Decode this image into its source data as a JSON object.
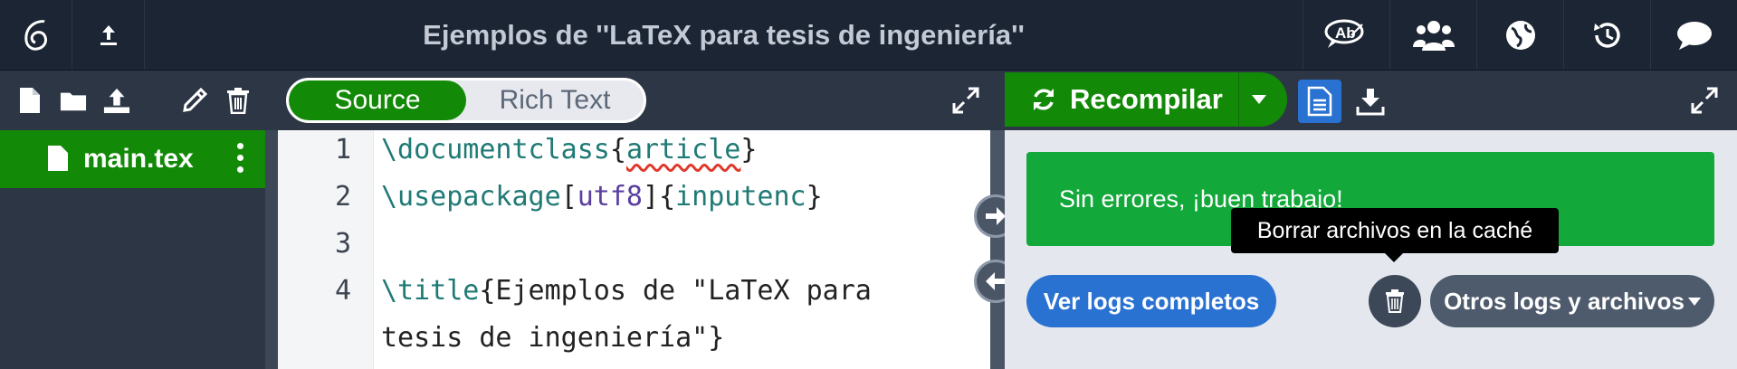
{
  "header": {
    "title": "Ejemplos de ''LaTeX para tesis de ingeniería''",
    "icons": [
      "overleaf-logo-icon",
      "upload-arrow-icon",
      "spellcheck-icon",
      "users-icon",
      "globe-icon",
      "history-icon",
      "chat-icon"
    ]
  },
  "file_toolbar": {
    "icons": [
      "new-file-icon",
      "new-folder-icon",
      "upload-icon",
      "rename-icon",
      "delete-icon"
    ]
  },
  "editor_toolbar": {
    "source_label": "Source",
    "rich_text_label": "Rich Text"
  },
  "file_tree": {
    "items": [
      {
        "label": "main.tex"
      }
    ]
  },
  "editor": {
    "lines": [
      {
        "n": "1",
        "cmd": "\\documentclass",
        "open": "{",
        "arg": "article",
        "close": "}"
      },
      {
        "n": "2",
        "cmd": "\\usepackage",
        "opt_open": "[",
        "opt": "utf8",
        "opt_close": "]",
        "open": "{",
        "arg": "inputenc",
        "close": "}"
      },
      {
        "n": "3"
      },
      {
        "n": "4",
        "cmd": "\\title",
        "text1": "{Ejemplos de \"LaTeX para",
        "text2": "tesis de ingeniería\"}"
      }
    ]
  },
  "pdf_toolbar": {
    "recompile_label": "Recompilar"
  },
  "logs": {
    "success_message": "Sin errores, ¡buen trabajo!",
    "view_logs_label": "Ver logs completos",
    "other_logs_label": "Otros logs y archivos",
    "tooltip": "Borrar archivos en la caché"
  },
  "colors": {
    "green": "#138a07",
    "success_green": "#13a83a",
    "blue": "#2a72d1",
    "dark": "#1c2533"
  }
}
